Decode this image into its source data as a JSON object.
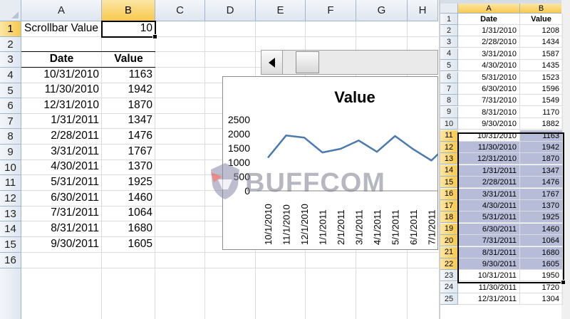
{
  "left_sheet": {
    "columns": [
      "A",
      "B",
      "C",
      "D",
      "E",
      "F",
      "G",
      "H"
    ],
    "rows": [
      "1",
      "2",
      "3",
      "4",
      "5",
      "6",
      "7",
      "8",
      "9",
      "10",
      "11",
      "12",
      "13",
      "14",
      "15",
      "16"
    ],
    "a1": "Scrollbar Value",
    "b1": "10",
    "header_date": "Date",
    "header_value": "Value",
    "table": [
      {
        "date": "10/31/2010",
        "value": "1163"
      },
      {
        "date": "11/30/2010",
        "value": "1942"
      },
      {
        "date": "12/31/2010",
        "value": "1870"
      },
      {
        "date": "1/31/2011",
        "value": "1347"
      },
      {
        "date": "2/28/2011",
        "value": "1476"
      },
      {
        "date": "3/31/2011",
        "value": "1767"
      },
      {
        "date": "4/30/2011",
        "value": "1370"
      },
      {
        "date": "5/31/2011",
        "value": "1925"
      },
      {
        "date": "6/30/2011",
        "value": "1460"
      },
      {
        "date": "7/31/2011",
        "value": "1064"
      },
      {
        "date": "8/31/2011",
        "value": "1680"
      },
      {
        "date": "9/30/2011",
        "value": "1605"
      }
    ]
  },
  "scrollbar": {
    "value": 10,
    "left_arrow_icon": "chevron-left-icon"
  },
  "chart": {
    "title": "Value",
    "y_ticks": [
      "2500",
      "2000",
      "1500",
      "1000",
      "500",
      "0"
    ],
    "x_ticks": [
      "10/1/2010",
      "11/1/2010",
      "12/1/2010",
      "1/1/2011",
      "2/1/2011",
      "3/1/2011",
      "4/1/2011",
      "5/1/2011",
      "6/1/2011",
      "7/1/2011"
    ],
    "line_color": "#4a7ab0"
  },
  "chart_data": {
    "type": "line",
    "title": "Value",
    "xlabel": "",
    "ylabel": "",
    "ylim": [
      0,
      2500
    ],
    "grid": false,
    "x": [
      "10/31/2010",
      "11/30/2010",
      "12/31/2010",
      "1/31/2011",
      "2/28/2011",
      "3/31/2011",
      "4/30/2011",
      "5/31/2011",
      "6/30/2011",
      "7/31/2011",
      "8/31/2011",
      "9/30/2011"
    ],
    "series": [
      {
        "values": [
          1163,
          1942,
          1870,
          1347,
          1476,
          1767,
          1370,
          1925,
          1460,
          1064,
          1680,
          1605
        ]
      }
    ]
  },
  "watermark": {
    "text": "BUFFCOM"
  },
  "right_sheet": {
    "col_a": "A",
    "col_b": "B",
    "header_date": "Date",
    "header_value": "Value",
    "rows": [
      {
        "row": "2",
        "date": "1/31/2010",
        "value": "1208"
      },
      {
        "row": "3",
        "date": "2/28/2010",
        "value": "1434"
      },
      {
        "row": "4",
        "date": "3/31/2010",
        "value": "1587"
      },
      {
        "row": "5",
        "date": "4/30/2010",
        "value": "1435"
      },
      {
        "row": "6",
        "date": "5/31/2010",
        "value": "1523"
      },
      {
        "row": "7",
        "date": "6/30/2010",
        "value": "1596"
      },
      {
        "row": "8",
        "date": "7/31/2010",
        "value": "1549"
      },
      {
        "row": "9",
        "date": "8/31/2010",
        "value": "1170"
      },
      {
        "row": "10",
        "date": "9/30/2010",
        "value": "1882"
      },
      {
        "row": "11",
        "date": "10/31/2010",
        "value": "1163"
      },
      {
        "row": "12",
        "date": "11/30/2010",
        "value": "1942"
      },
      {
        "row": "13",
        "date": "12/31/2010",
        "value": "1870"
      },
      {
        "row": "14",
        "date": "1/31/2011",
        "value": "1347"
      },
      {
        "row": "15",
        "date": "2/28/2011",
        "value": "1476"
      },
      {
        "row": "16",
        "date": "3/31/2011",
        "value": "1767"
      },
      {
        "row": "17",
        "date": "4/30/2011",
        "value": "1370"
      },
      {
        "row": "18",
        "date": "5/31/2011",
        "value": "1925"
      },
      {
        "row": "19",
        "date": "6/30/2011",
        "value": "1460"
      },
      {
        "row": "20",
        "date": "7/31/2011",
        "value": "1064"
      },
      {
        "row": "21",
        "date": "8/31/2011",
        "value": "1680"
      },
      {
        "row": "22",
        "date": "9/30/2011",
        "value": "1605"
      },
      {
        "row": "23",
        "date": "10/31/2011",
        "value": "1950"
      },
      {
        "row": "24",
        "date": "11/30/2011",
        "value": "1720"
      },
      {
        "row": "25",
        "date": "12/31/2011",
        "value": "1304"
      }
    ],
    "row1": "1"
  }
}
